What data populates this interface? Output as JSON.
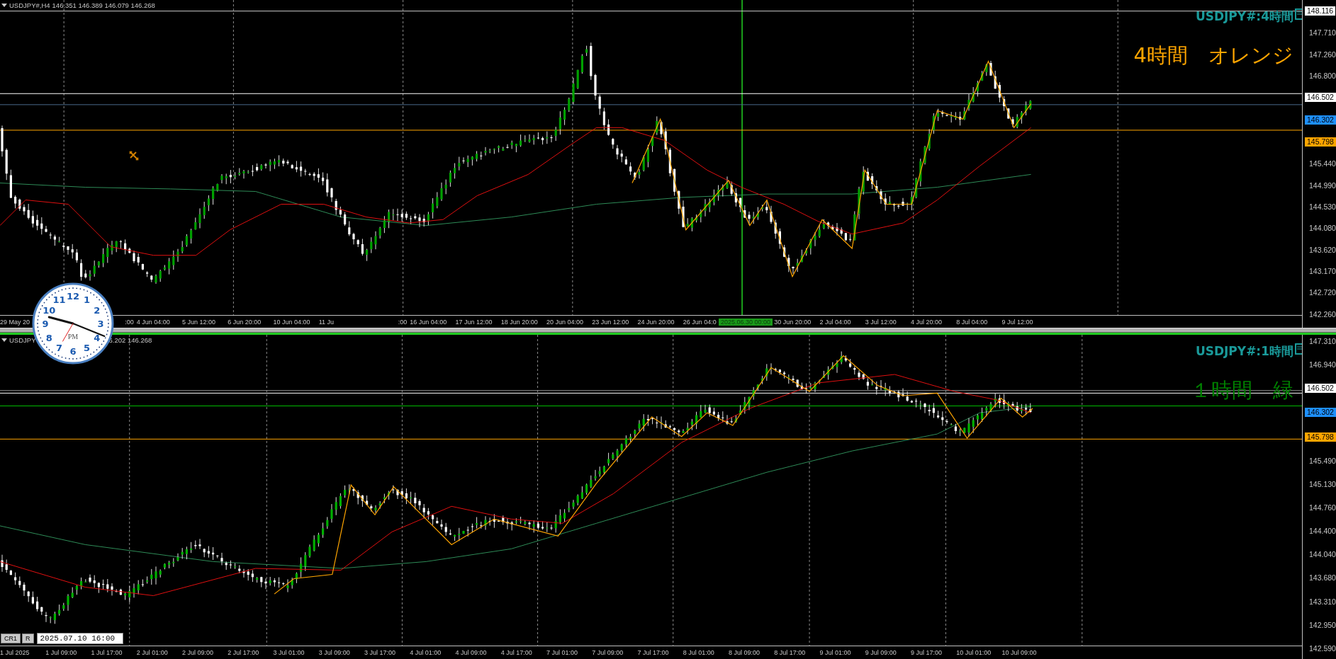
{
  "charts": [
    {
      "header": {
        "symbol": "USDJPY#,H4",
        "quotes": "146.351 146.389 146.079 146.268"
      },
      "title": "USDJPY#:4時間",
      "note": {
        "text": "4時間　オレンジ",
        "color": "#ffa500"
      },
      "price_axis": [
        {
          "text": "148.116",
          "kind": "marker",
          "color": "#ffffff"
        },
        {
          "text": "147.710",
          "kind": "tick"
        },
        {
          "text": "147.260",
          "kind": "tick"
        },
        {
          "text": "146.800",
          "kind": "tick"
        },
        {
          "text": "146.502",
          "kind": "marker",
          "color": "#ffffff"
        },
        {
          "text": "146.302",
          "kind": "marker",
          "color": "#1e90ff"
        },
        {
          "text": "145.798",
          "kind": "marker",
          "color": "#ffa500"
        },
        {
          "text": "145.440",
          "kind": "tick"
        },
        {
          "text": "144.990",
          "kind": "tick"
        },
        {
          "text": "144.530",
          "kind": "tick"
        },
        {
          "text": "144.080",
          "kind": "tick"
        },
        {
          "text": "143.620",
          "kind": "tick"
        },
        {
          "text": "143.170",
          "kind": "tick"
        },
        {
          "text": "142.720",
          "kind": "tick"
        },
        {
          "text": "142.260",
          "kind": "tick"
        }
      ],
      "time_axis": [
        {
          "text": "29 May 20",
          "kind": "label"
        },
        {
          "text": ":00",
          "kind": "label"
        },
        {
          "text": "4 Jun 04:00",
          "kind": "label"
        },
        {
          "text": "5 Jun 12:00",
          "kind": "label"
        },
        {
          "text": "6 Jun 20:00",
          "kind": "label"
        },
        {
          "text": "10 Jun 04:00",
          "kind": "label"
        },
        {
          "text": "11 Ju",
          "kind": "label"
        },
        {
          "text": ":00",
          "kind": "label"
        },
        {
          "text": "16 Jun 04:00",
          "kind": "label"
        },
        {
          "text": "17 Jun 12:00",
          "kind": "label"
        },
        {
          "text": "18 Jun 20:00",
          "kind": "label"
        },
        {
          "text": "20 Jun 04:00",
          "kind": "label"
        },
        {
          "text": "23 Jun 12:00",
          "kind": "label"
        },
        {
          "text": "24 Jun 20:00",
          "kind": "label"
        },
        {
          "text": "26 Jun 04:0",
          "kind": "label"
        },
        {
          "text": "2025.06.30 00:00",
          "kind": "marker"
        },
        {
          "text": "30 Jun 20:00",
          "kind": "label"
        },
        {
          "text": "2 Jul 04:00",
          "kind": "label"
        },
        {
          "text": "3 Jul 12:00",
          "kind": "label"
        },
        {
          "text": "4 Jul 20:00",
          "kind": "label"
        },
        {
          "text": "8 Jul 04:00",
          "kind": "label"
        },
        {
          "text": "9 Jul 12:00",
          "kind": "label"
        }
      ]
    },
    {
      "header": {
        "symbol": "USDJPY",
        "quotes": "6.202 146.268"
      },
      "title": "USDJPY#:1時間",
      "note": {
        "text": "１時間　緑",
        "color": "#008000"
      },
      "price_axis": [
        {
          "text": "147.310",
          "kind": "tick"
        },
        {
          "text": "146.940",
          "kind": "tick"
        },
        {
          "text": "146.502",
          "kind": "marker",
          "color": "#ffffff"
        },
        {
          "text": "146.302",
          "kind": "marker",
          "color": "#1e90ff"
        },
        {
          "text": "145.798",
          "kind": "marker",
          "color": "#ffa500"
        },
        {
          "text": "145.490",
          "kind": "tick"
        },
        {
          "text": "145.130",
          "kind": "tick"
        },
        {
          "text": "144.760",
          "kind": "tick"
        },
        {
          "text": "144.400",
          "kind": "tick"
        },
        {
          "text": "144.040",
          "kind": "tick"
        },
        {
          "text": "143.680",
          "kind": "tick"
        },
        {
          "text": "143.310",
          "kind": "tick"
        },
        {
          "text": "142.950",
          "kind": "tick"
        },
        {
          "text": "142.590",
          "kind": "tick"
        }
      ],
      "time_axis": [
        {
          "text": "1 Jul 2025",
          "kind": "label"
        },
        {
          "text": "1 Jul 09:00",
          "kind": "label"
        },
        {
          "text": "1 Jul 17:00",
          "kind": "label"
        },
        {
          "text": "2 Jul 01:00",
          "kind": "label"
        },
        {
          "text": "2 Jul 09:00",
          "kind": "label"
        },
        {
          "text": "2 Jul 17:00",
          "kind": "label"
        },
        {
          "text": "3 Jul 01:00",
          "kind": "label"
        },
        {
          "text": "3 Jul 09:00",
          "kind": "label"
        },
        {
          "text": "3 Jul 17:00",
          "kind": "label"
        },
        {
          "text": "4 Jul 01:00",
          "kind": "label"
        },
        {
          "text": "4 Jul 09:00",
          "kind": "label"
        },
        {
          "text": "4 Jul 17:00",
          "kind": "label"
        },
        {
          "text": "7 Jul 01:00",
          "kind": "label"
        },
        {
          "text": "7 Jul 09:00",
          "kind": "label"
        },
        {
          "text": "7 Jul 17:00",
          "kind": "label"
        },
        {
          "text": "8 Jul 01:00",
          "kind": "label"
        },
        {
          "text": "8 Jul 09:00",
          "kind": "label"
        },
        {
          "text": "8 Jul 17:00",
          "kind": "label"
        },
        {
          "text": "9 Jul 01:00",
          "kind": "label"
        },
        {
          "text": "9 Jul 09:00",
          "kind": "label"
        },
        {
          "text": "9 Jul 17:00",
          "kind": "label"
        },
        {
          "text": "10 Jul 01:00",
          "kind": "label"
        },
        {
          "text": "10 Jul 09:00",
          "kind": "label"
        }
      ],
      "controls": {
        "buttons": [
          "CR1",
          "R"
        ],
        "date_field": "2025.07.10 16:00"
      }
    }
  ],
  "clock": {
    "numbers": [
      "12",
      "11",
      "1",
      "10",
      "2",
      "9",
      "3",
      "8",
      "4",
      "7",
      "5",
      "6"
    ],
    "period": "PM"
  }
}
